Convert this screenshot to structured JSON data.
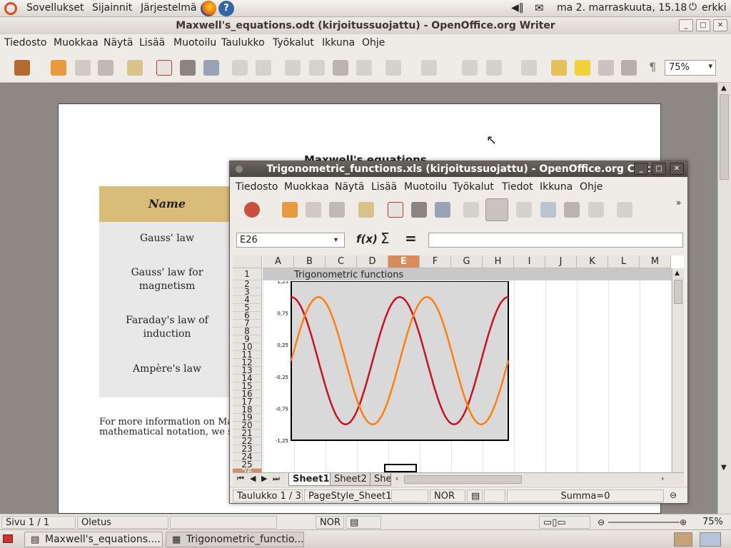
{
  "top_panel": {
    "menus": [
      "Sovellukset",
      "Sijainnit",
      "Järjestelmä"
    ],
    "clock": "ma  2. marraskuuta, 15.18",
    "user": "erkki"
  },
  "writer": {
    "title": "Maxwell's_equations.odt (kirjoitussuojattu) - OpenOffice.org Writer",
    "menu": [
      "Tiedosto",
      "Muokkaa",
      "Näytä",
      "Lisää",
      "Muotoilu",
      "Taulukko",
      "Työkalut",
      "Ikkuna",
      "Ohje"
    ],
    "zoom": "75%",
    "doc_title": "Maxwell's equations",
    "table_header": "Name",
    "table_rows": [
      "Gauss' law",
      "Gauss' law for magnetism",
      "Faraday's law of induction",
      "Ampère's law"
    ],
    "info_line1": "For more information on Max",
    "info_line2": "mathematical notation, we su",
    "status": {
      "page": "Sivu 1 / 1",
      "style": "Oletus",
      "mode": "NOR",
      "zoom": "75%"
    }
  },
  "calc": {
    "title": "Trigonometric_functions.xls (kirjoitussuojattu) - OpenOffice.org Calc",
    "menu": [
      "Tiedosto",
      "Muokkaa",
      "Näytä",
      "Lisää",
      "Muotoilu",
      "Työkalut",
      "Tiedot",
      "Ikkuna",
      "Ohje"
    ],
    "name_box": "E26",
    "columns": [
      "A",
      "B",
      "C",
      "D",
      "E",
      "F",
      "G",
      "H",
      "I",
      "J",
      "K",
      "L",
      "M"
    ],
    "rows": [
      "1",
      "2",
      "3",
      "4",
      "5",
      "6",
      "7",
      "8",
      "9",
      "10",
      "11",
      "12",
      "13",
      "14",
      "15",
      "16",
      "17",
      "18",
      "19",
      "20",
      "21",
      "22",
      "23",
      "24",
      "25",
      "26"
    ],
    "a1_text": "Trigonometric functions",
    "sheets": [
      "Sheet1",
      "Sheet2",
      "She"
    ],
    "status": {
      "sheet": "Taulukko 1 / 3",
      "pagestyle": "PageStyle_Sheet1",
      "mode": "NOR",
      "sum": "Summa=0"
    }
  },
  "taskbar": {
    "items": [
      "Maxwell's_equations....",
      "Trigonometric_functio..."
    ]
  },
  "chart_data": {
    "type": "line",
    "title": "",
    "xlabel": "",
    "ylabel": "",
    "ylim": [
      -1.25,
      1.25
    ],
    "yticks": [
      "1,25",
      "0,75",
      "0,25",
      "-0,25",
      "-0,75",
      "-1,25"
    ],
    "xlim": [
      0,
      12.566
    ],
    "series": [
      {
        "color": "#cc1122",
        "x": [
          0,
          1.571,
          3.142,
          4.712,
          6.283,
          7.854,
          9.425,
          10.996,
          12.566
        ],
        "y": [
          1,
          0,
          -1,
          0,
          1,
          0,
          -1,
          0,
          1
        ]
      },
      {
        "color": "#ff7f0e",
        "x": [
          0,
          1.571,
          3.142,
          4.712,
          6.283,
          7.854,
          9.425,
          10.996,
          12.566
        ],
        "y": [
          0,
          1,
          0,
          -1,
          0,
          1,
          0,
          -1,
          0
        ]
      }
    ],
    "grid": false
  }
}
